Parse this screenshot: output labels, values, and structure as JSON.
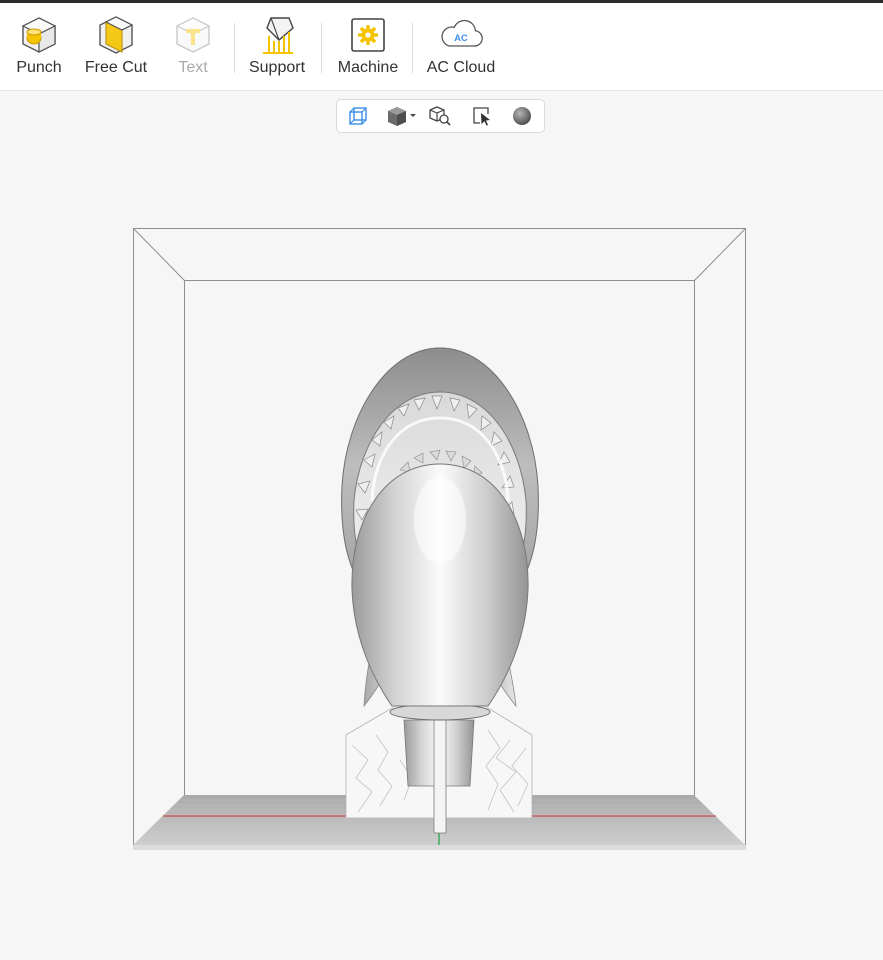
{
  "toolbar": {
    "tools": [
      {
        "label": "Punch",
        "icon": "punch-icon",
        "enabled": true
      },
      {
        "label": "Free Cut",
        "icon": "free-cut-icon",
        "enabled": true
      },
      {
        "label": "Text",
        "icon": "text-icon",
        "enabled": false
      },
      {
        "label": "Support",
        "icon": "support-icon",
        "enabled": true
      },
      {
        "label": "Machine",
        "icon": "machine-icon",
        "enabled": true
      },
      {
        "label": "AC Cloud",
        "icon": "ac-cloud-icon",
        "enabled": true
      }
    ],
    "cloud_icon_text": "AC"
  },
  "view_controls": [
    {
      "icon": "perspective-view-icon"
    },
    {
      "icon": "view-cube-dropdown-icon"
    },
    {
      "icon": "zoom-to-fit-icon"
    },
    {
      "icon": "select-object-icon"
    },
    {
      "icon": "shading-sphere-icon"
    }
  ],
  "colors": {
    "accent": "#f5c400",
    "brand_blue": "#3a8ee6",
    "bed_axis_x": "#cc3333",
    "bed_axis_y": "#33aa55"
  }
}
